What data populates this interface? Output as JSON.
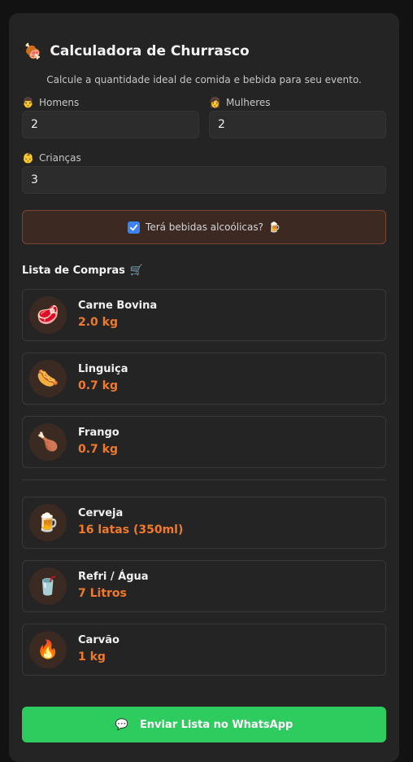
{
  "header": {
    "icon": "meat-on-bone-icon",
    "title": "Calculadora de Churrasco",
    "subtitle": "Calcule a quantidade ideal de comida e bebida para seu evento."
  },
  "fields": {
    "homens": {
      "label": "Homens",
      "value": "2",
      "icon": "man-icon"
    },
    "mulheres": {
      "label": "Mulheres",
      "value": "2",
      "icon": "woman-icon"
    },
    "criancas": {
      "label": "Crianças",
      "value": "3",
      "icon": "child-icon"
    }
  },
  "alcohol": {
    "label": "Terá bebidas alcoólicas?",
    "checked": true,
    "icon": "beer-mug-icon",
    "accent": "#3b82f6"
  },
  "list": {
    "title": "Lista de Compras",
    "icon": "shopping-cart-icon",
    "items": [
      {
        "name": "Carne Bovina",
        "value": "2.0 kg",
        "icon": "meat-icon"
      },
      {
        "name": "Linguiça",
        "value": "0.7 kg",
        "icon": "hotdog-icon"
      },
      {
        "name": "Frango",
        "value": "0.7 kg",
        "icon": "poultry-leg-icon"
      },
      {
        "name": "Cerveja",
        "value": "16 latas (350ml)",
        "icon": "beer-icon"
      },
      {
        "name": "Refri / Água",
        "value": "7 Litros",
        "icon": "cup-with-straw-icon"
      },
      {
        "name": "Carvão",
        "value": "1 kg",
        "icon": "fire-icon"
      }
    ]
  },
  "colors": {
    "accent_orange": "#f07a2a",
    "whatsapp_green": "#2ecc5e",
    "card_bg": "#242424"
  },
  "whatsapp_button": {
    "label": "Enviar Lista no WhatsApp",
    "icon": "speech-bubble-icon"
  }
}
